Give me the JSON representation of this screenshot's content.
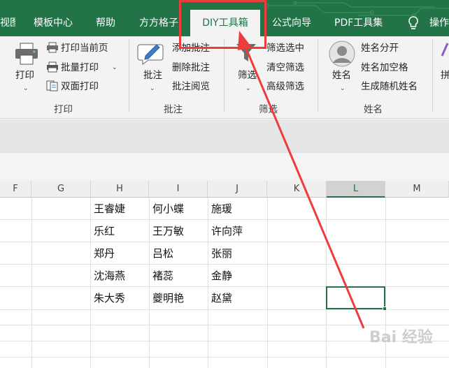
{
  "tabs": [
    {
      "label": "视图"
    },
    {
      "label": "模板中心"
    },
    {
      "label": "帮助"
    },
    {
      "label": "方方格子"
    },
    {
      "label": "DIY工具箱"
    },
    {
      "label": "公式向导"
    },
    {
      "label": "PDF工具集"
    },
    {
      "label": "操作"
    }
  ],
  "print_group": {
    "print_label": "打印",
    "print_current": "打印当前页",
    "batch_print": "批量打印",
    "duplex_print": "双面打印",
    "group_label": "打印"
  },
  "annotation_group": {
    "annotate_label": "批注",
    "add_note": "添加批注",
    "delete_note": "删除批注",
    "browse_note": "批注阅览",
    "group_label": "批注"
  },
  "filter_group": {
    "filter_label": "筛选",
    "filter_selected": "筛选选中",
    "clear_filter": "清空筛选",
    "advanced_filter": "高级筛选",
    "group_label": "筛选"
  },
  "name_group": {
    "name_label": "姓名",
    "split_name": "姓名分开",
    "name_spaces": "姓名加空格",
    "random_name": "生成随机姓名",
    "group_label": "姓名"
  },
  "next_group": {
    "label": "拼"
  },
  "columns": [
    "F",
    "G",
    "H",
    "I",
    "J",
    "K",
    "L",
    "M"
  ],
  "selected_column": "L",
  "rows": [
    [
      "王睿婕",
      "何小蝶",
      "施瑗"
    ],
    [
      "乐红",
      "王万敏",
      "许向萍"
    ],
    [
      "郑丹",
      "吕松",
      "张丽"
    ],
    [
      "沈海燕",
      "褚蕊",
      "金静"
    ],
    [
      "朱大秀",
      "夔明艳",
      "赵黛"
    ]
  ],
  "watermark": "Bai 经验",
  "colors": {
    "excel_green": "#227447",
    "highlight_red": "#ee3b3b"
  }
}
